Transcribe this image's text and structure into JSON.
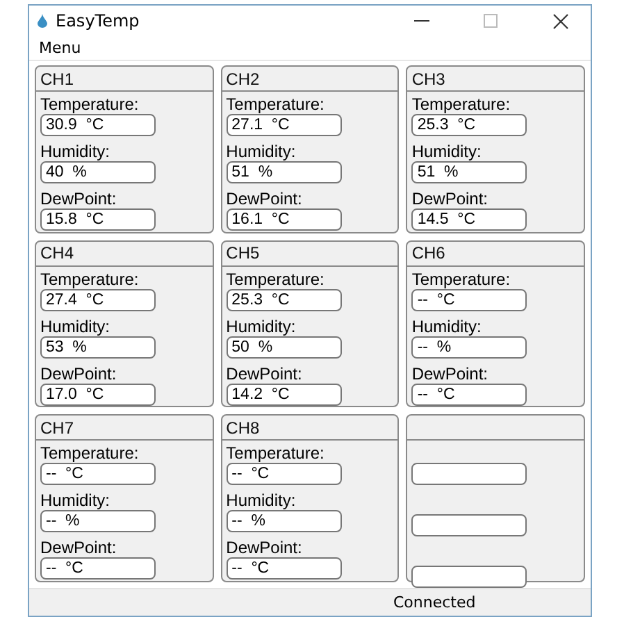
{
  "window": {
    "title": "EasyTemp"
  },
  "menu": [
    "Menu"
  ],
  "channels": [
    {
      "kind": "channel",
      "name": "CH1",
      "readings": [
        {
          "label": "Temperature:",
          "value": "30.9  °C"
        },
        {
          "label": "Humidity:",
          "value": "40  %"
        },
        {
          "label": "DewPoint:",
          "value": "15.8  °C"
        }
      ]
    },
    {
      "kind": "channel",
      "name": "CH2",
      "readings": [
        {
          "label": "Temperature:",
          "value": "27.1  °C"
        },
        {
          "label": "Humidity:",
          "value": "51  %"
        },
        {
          "label": "DewPoint:",
          "value": "16.1  °C"
        }
      ]
    },
    {
      "kind": "channel",
      "name": "CH3",
      "readings": [
        {
          "label": "Temperature:",
          "value": "25.3  °C"
        },
        {
          "label": "Humidity:",
          "value": "51  %"
        },
        {
          "label": "DewPoint:",
          "value": "14.5  °C"
        }
      ]
    },
    {
      "kind": "channel",
      "name": "CH4",
      "readings": [
        {
          "label": "Temperature:",
          "value": "27.4  °C"
        },
        {
          "label": "Humidity:",
          "value": "53  %"
        },
        {
          "label": "DewPoint:",
          "value": "17.0  °C"
        }
      ]
    },
    {
      "kind": "channel",
      "name": "CH5",
      "readings": [
        {
          "label": "Temperature:",
          "value": "25.3  °C"
        },
        {
          "label": "Humidity:",
          "value": "50  %"
        },
        {
          "label": "DewPoint:",
          "value": "14.2  °C"
        }
      ]
    },
    {
      "kind": "channel",
      "name": "CH6",
      "readings": [
        {
          "label": "Temperature:",
          "value": "--  °C"
        },
        {
          "label": "Humidity:",
          "value": "--  %"
        },
        {
          "label": "DewPoint:",
          "value": "--  °C"
        }
      ]
    },
    {
      "kind": "channel",
      "name": "CH7",
      "readings": [
        {
          "label": "Temperature:",
          "value": "--  °C"
        },
        {
          "label": "Humidity:",
          "value": "--  %"
        },
        {
          "label": "DewPoint:",
          "value": "--  °C"
        }
      ]
    },
    {
      "kind": "channel",
      "name": "CH8",
      "readings": [
        {
          "label": "Temperature:",
          "value": "--  °C"
        },
        {
          "label": "Humidity:",
          "value": "--  %"
        },
        {
          "label": "DewPoint:",
          "value": "--  °C"
        }
      ]
    },
    {
      "kind": "empty"
    }
  ],
  "status_bar": {
    "status": "Connected"
  }
}
